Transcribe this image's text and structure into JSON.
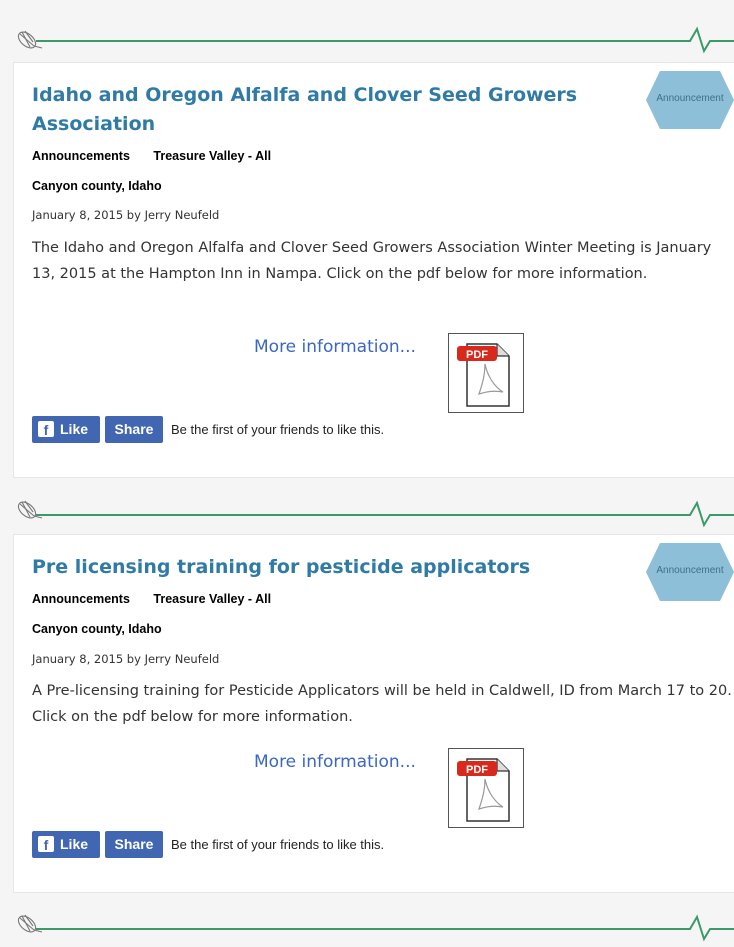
{
  "posts": [
    {
      "title": "Idaho and Oregon Alfalfa and Clover Seed Growers Association",
      "badge": "Announcement",
      "category": "Announcements",
      "region": "Treasure Valley - All",
      "county": "Canyon county, Idaho",
      "byline": "January 8, 2015 by Jerry Neufeld",
      "body": "The Idaho and Oregon Alfalfa and Clover Seed Growers Association Winter Meeting is January 13, 2015 at the Hampton Inn in Nampa. Click on the pdf below for more information.",
      "more_link": "More information...",
      "pdf_label": "PDF",
      "like_label": "Like",
      "share_label": "Share",
      "social_text": "Be the first of your friends to like this."
    },
    {
      "title": "Pre licensing training for pesticide applicators",
      "badge": "Announcement",
      "category": "Announcements",
      "region": "Treasure Valley - All",
      "county": "Canyon county, Idaho",
      "byline": "January 8, 2015 by Jerry Neufeld",
      "body": "A Pre-licensing training for Pesticide Applicators will be held in Caldwell, ID from March 17 to 20. Click on the pdf below for more information.",
      "more_link": "More information...",
      "pdf_label": "PDF",
      "like_label": "Like",
      "share_label": "Share",
      "social_text": "Be the first of your friends to like this."
    }
  ],
  "icons": {
    "divider": "wheat-sprig-icon",
    "pdf": "pdf-file-icon",
    "facebook": "facebook-f-icon",
    "badge": "hexagon-badge"
  },
  "colors": {
    "title": "#2f7ba6",
    "link": "#3a66c4",
    "divider_line": "#3c9a6a",
    "badge_fill": "#8ebfd8",
    "facebook": "#4267b2",
    "pdf_red": "#d9281c"
  }
}
